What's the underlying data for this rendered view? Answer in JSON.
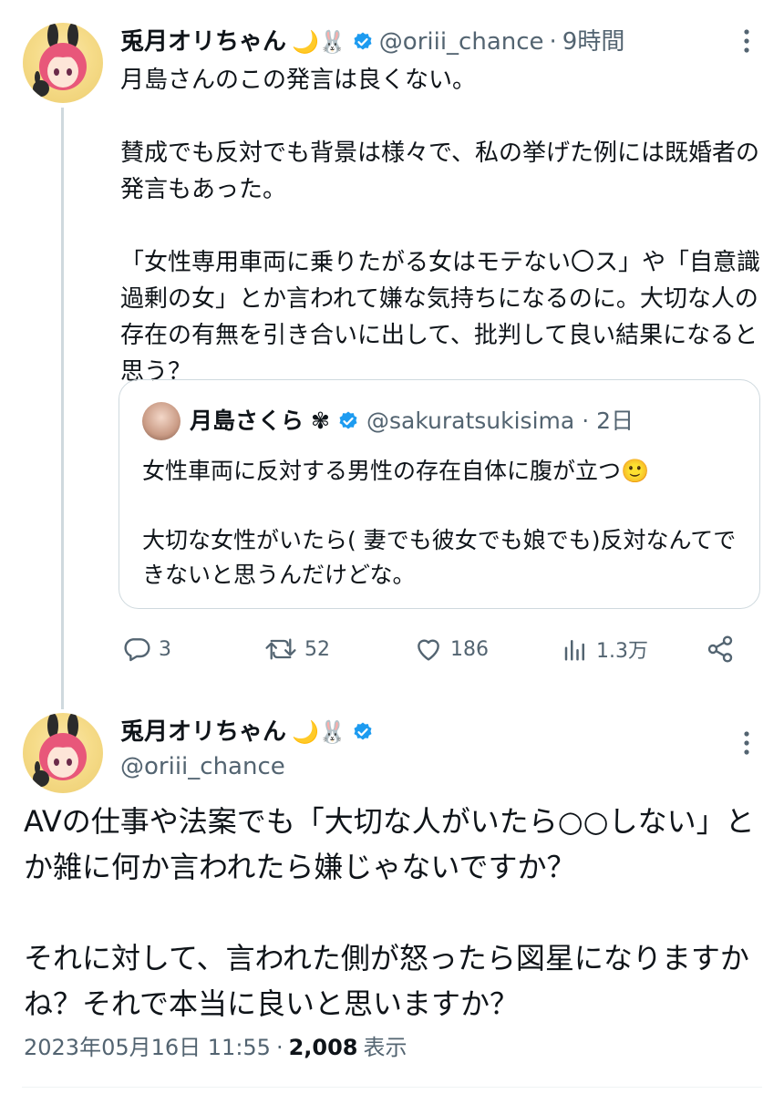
{
  "tweet1": {
    "author_name": "兎月オリちゃん",
    "author_emojis": "🌙🐰",
    "author_handle": "@oriii_chance",
    "separator": "·",
    "time": "9時間",
    "text": "月島さんのこの発言は良くない。\n\n賛成でも反対でも背景は様々で、私の挙げた例には既婚者の発言もあった。\n\n「女性専用車両に乗りたがる女はモテない〇ス」や「自意識過剰の女」とか言われて嫌な気持ちになるのに。大切な人の存在の有無を引き合いに出して、批判して良い結果になると思う？",
    "quote": {
      "author_name": "月島さくら",
      "author_emoji": "✾",
      "author_handle": "@sakuratsukisima",
      "separator": "·",
      "time": "2日",
      "text": "女性車両に反対する男性の存在自体に腹が立つ🙂\n\n大切な女性がいたら( 妻でも彼女でも娘でも)反対なんてできないと思うんだけどな。"
    },
    "actions": {
      "replies": "3",
      "retweets": "52",
      "likes": "186",
      "views": "1.3万"
    }
  },
  "tweet2": {
    "author_name": "兎月オリちゃん",
    "author_emojis": "🌙🐰",
    "author_handle": "@oriii_chance",
    "text": "AVの仕事や法案でも「大切な人がいたら○○しない」とか雑に何か言われたら嫌じゃないですか？\n\nそれに対して、言われた側が怒ったら図星になりますかね？それで本当に良いと思いますか？",
    "timestamp": "2023年05月16日 11:55",
    "separator": "·",
    "views_count": "2,008",
    "views_label": "表示"
  },
  "colors": {
    "verified_blue": "#1d9bf0",
    "secondary_text": "#536471",
    "border": "#cfd9de"
  },
  "icons": {
    "more": "more-horizontal-icon",
    "reply": "reply-bubble-icon",
    "retweet": "retweet-icon",
    "like": "heart-icon",
    "views": "bar-chart-icon",
    "share": "share-icon",
    "verified": "verified-badge-icon"
  }
}
